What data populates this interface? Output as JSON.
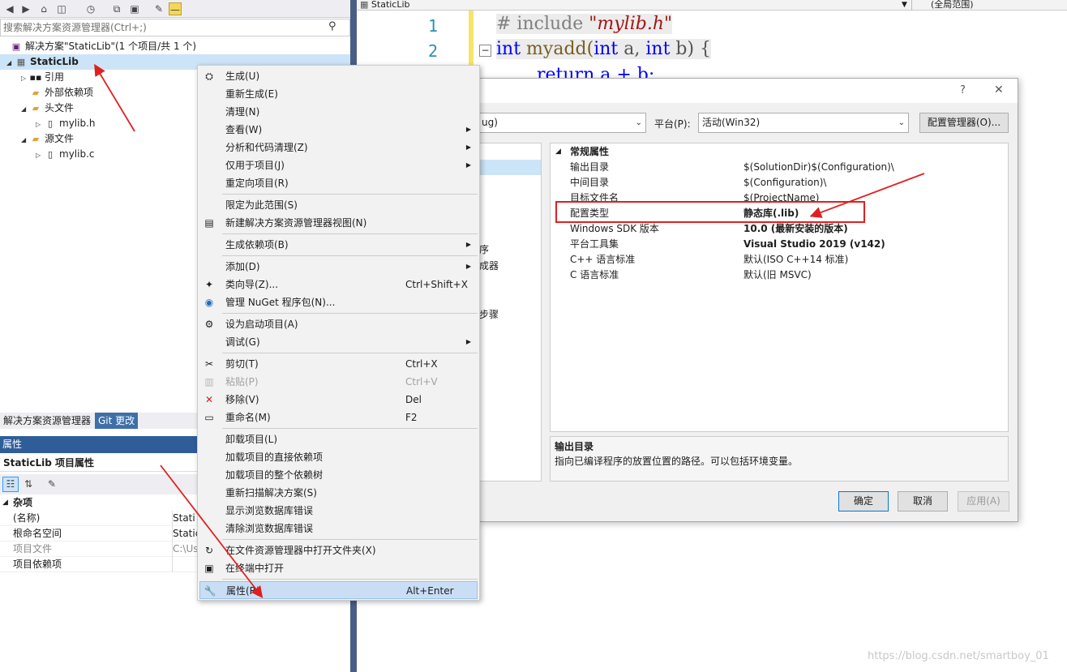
{
  "solution_explorer": {
    "search_placeholder": "搜索解决方案资源管理器(Ctrl+;)",
    "solution": "解决方案\"StaticLib\"(1 个项目/共 1 个)",
    "project": "StaticLib",
    "nodes": [
      "引用",
      "外部依赖项",
      "头文件",
      "mylib.h",
      "源文件",
      "mylib.c"
    ],
    "tabs": [
      "解决方案资源管理器",
      "Git 更改"
    ]
  },
  "properties": {
    "title": "属性",
    "selected_object": "StaticLib 项目属性",
    "category": "杂项",
    "rows": [
      {
        "name": "(名称)",
        "value": "Stati"
      },
      {
        "name": "根命名空间",
        "value": "Static"
      },
      {
        "name": "项目文件",
        "value": "C:\\Us"
      },
      {
        "name": "项目依赖项",
        "value": ""
      }
    ]
  },
  "editor": {
    "file_tab": "StaticLib",
    "scope": "(全局范围)",
    "line_numbers": [
      "1",
      "2"
    ],
    "line1_keyword": "# include",
    "line1_string": "\"mylib.h\"",
    "line2_kw1": "int",
    "line2_name": " myadd(",
    "line2_kw2": "int",
    "line2_a": " a, ",
    "line2_kw3": "int",
    "line2_b": " b) {",
    "line3": "return a + b;"
  },
  "dialog": {
    "help": "?",
    "close": "✕",
    "config_value": "ug)",
    "platform_label": "平台(P):",
    "platform_value": "活动(Win32)",
    "config_manager": "配置管理器(O)...",
    "left_fragments": [
      "序",
      "成器",
      "步骤"
    ],
    "section": "常规属性",
    "grid": [
      {
        "name": "输出目录",
        "value": "$(SolutionDir)$(Configuration)\\",
        "bold": false
      },
      {
        "name": "中间目录",
        "value": "$(Configuration)\\",
        "bold": false
      },
      {
        "name": "目标文件名",
        "value": "$(ProjectName)",
        "bold": false
      },
      {
        "name": "配置类型",
        "value": "静态库(.lib)",
        "bold": true
      },
      {
        "name": "Windows SDK 版本",
        "value": "10.0 (最新安装的版本)",
        "bold": true
      },
      {
        "name": "平台工具集",
        "value": "Visual Studio 2019 (v142)",
        "bold": true
      },
      {
        "name": "C++ 语言标准",
        "value": "默认(ISO C++14 标准)",
        "bold": false
      },
      {
        "name": "C 语言标准",
        "value": "默认(旧 MSVC)",
        "bold": false
      }
    ],
    "desc_title": "输出目录",
    "desc_text": "指向已编译程序的放置位置的路径。可以包括环境变量。",
    "ok": "确定",
    "cancel": "取消",
    "apply": "应用(A)"
  },
  "context_menu": {
    "items": [
      {
        "label": "生成(U)",
        "shortcut": "",
        "icon": "build-icon",
        "sub": false,
        "disabled": false
      },
      {
        "label": "重新生成(E)",
        "shortcut": "",
        "icon": "",
        "sub": false,
        "disabled": false
      },
      {
        "label": "清理(N)",
        "shortcut": "",
        "icon": "",
        "sub": false,
        "disabled": false
      },
      {
        "label": "查看(W)",
        "shortcut": "",
        "icon": "",
        "sub": true,
        "disabled": false
      },
      {
        "label": "分析和代码清理(Z)",
        "shortcut": "",
        "icon": "",
        "sub": true,
        "disabled": false
      },
      {
        "label": "仅用于项目(J)",
        "shortcut": "",
        "icon": "",
        "sub": true,
        "disabled": false
      },
      {
        "label": "重定向项目(R)",
        "shortcut": "",
        "icon": "",
        "sub": false,
        "disabled": false
      },
      {
        "label": "限定为此范围(S)",
        "shortcut": "",
        "icon": "",
        "sub": false,
        "disabled": false
      },
      {
        "label": "新建解决方案资源管理器视图(N)",
        "shortcut": "",
        "icon": "new-view-icon",
        "sub": false,
        "disabled": false
      },
      {
        "label": "生成依赖项(B)",
        "shortcut": "",
        "icon": "",
        "sub": true,
        "disabled": false
      },
      {
        "label": "添加(D)",
        "shortcut": "",
        "icon": "",
        "sub": true,
        "disabled": false
      },
      {
        "label": "类向导(Z)...",
        "shortcut": "Ctrl+Shift+X",
        "icon": "class-wizard-icon",
        "sub": false,
        "disabled": false
      },
      {
        "label": "管理 NuGet 程序包(N)...",
        "shortcut": "",
        "icon": "nuget-icon",
        "sub": false,
        "disabled": false
      },
      {
        "label": "设为启动项目(A)",
        "shortcut": "",
        "icon": "gear-icon",
        "sub": false,
        "disabled": false
      },
      {
        "label": "调试(G)",
        "shortcut": "",
        "icon": "",
        "sub": true,
        "disabled": false
      },
      {
        "label": "剪切(T)",
        "shortcut": "Ctrl+X",
        "icon": "scissors-icon",
        "sub": false,
        "disabled": false
      },
      {
        "label": "粘贴(P)",
        "shortcut": "Ctrl+V",
        "icon": "paste-icon",
        "sub": false,
        "disabled": true
      },
      {
        "label": "移除(V)",
        "shortcut": "Del",
        "icon": "remove-icon",
        "sub": false,
        "disabled": false
      },
      {
        "label": "重命名(M)",
        "shortcut": "F2",
        "icon": "rename-icon",
        "sub": false,
        "disabled": false
      },
      {
        "label": "卸载项目(L)",
        "shortcut": "",
        "icon": "",
        "sub": false,
        "disabled": false
      },
      {
        "label": "加载项目的直接依赖项",
        "shortcut": "",
        "icon": "",
        "sub": false,
        "disabled": false
      },
      {
        "label": "加载项目的整个依赖树",
        "shortcut": "",
        "icon": "",
        "sub": false,
        "disabled": false
      },
      {
        "label": "重新扫描解决方案(S)",
        "shortcut": "",
        "icon": "",
        "sub": false,
        "disabled": false
      },
      {
        "label": "显示浏览数据库错误",
        "shortcut": "",
        "icon": "",
        "sub": false,
        "disabled": false
      },
      {
        "label": "清除浏览数据库错误",
        "shortcut": "",
        "icon": "",
        "sub": false,
        "disabled": false
      },
      {
        "label": "在文件资源管理器中打开文件夹(X)",
        "shortcut": "",
        "icon": "refresh-icon",
        "sub": false,
        "disabled": false
      },
      {
        "label": "在终端中打开",
        "shortcut": "",
        "icon": "terminal-icon",
        "sub": false,
        "disabled": false
      },
      {
        "label": "属性(R)",
        "shortcut": "Alt+Enter",
        "icon": "wrench-icon",
        "sub": false,
        "disabled": false
      }
    ]
  },
  "watermark": "https://blog.csdn.net/smartboy_01",
  "colors": {
    "accent": "#2f5d9a",
    "annotation": "#e02020",
    "highlight": "#cce4f7"
  }
}
